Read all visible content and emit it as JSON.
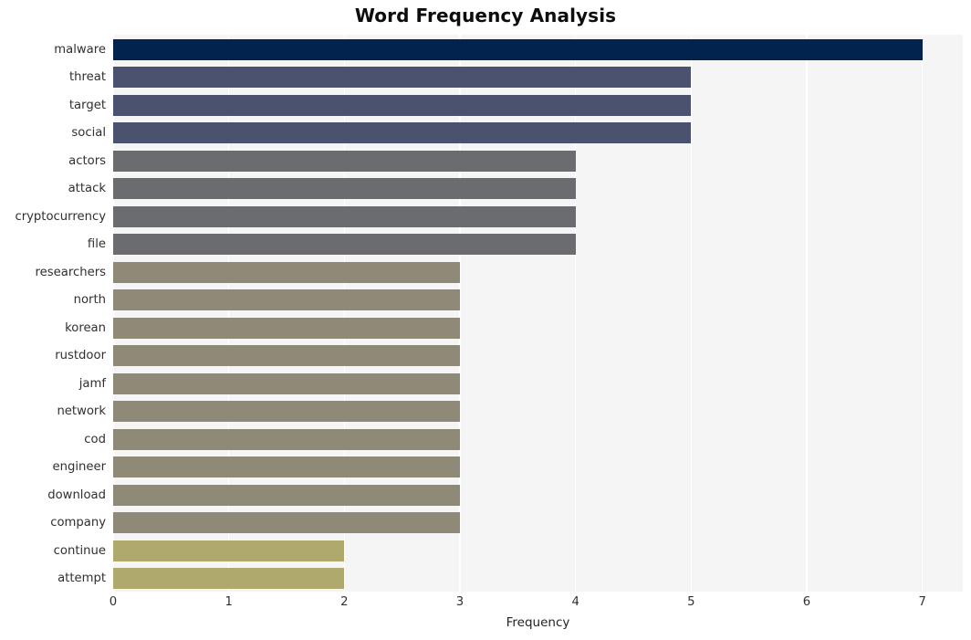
{
  "chart_data": {
    "type": "bar",
    "orientation": "horizontal",
    "title": "Word Frequency Analysis",
    "xlabel": "Frequency",
    "ylabel": "",
    "xlim": [
      0,
      7.35
    ],
    "xticks": [
      0,
      1,
      2,
      3,
      4,
      5,
      6,
      7
    ],
    "xtick_labels": [
      "0",
      "1",
      "2",
      "3",
      "4",
      "5",
      "6",
      "7"
    ],
    "grid": "vertical",
    "legend": "none",
    "categories": [
      "malware",
      "threat",
      "target",
      "social",
      "actors",
      "attack",
      "cryptocurrency",
      "file",
      "researchers",
      "north",
      "korean",
      "rustdoor",
      "jamf",
      "network",
      "cod",
      "engineer",
      "download",
      "company",
      "continue",
      "attempt"
    ],
    "values": [
      7,
      5,
      5,
      5,
      4,
      4,
      4,
      4,
      3,
      3,
      3,
      3,
      3,
      3,
      3,
      3,
      3,
      3,
      2,
      2
    ],
    "bar_colors": [
      "#03234f",
      "#4b5270",
      "#4b5270",
      "#4b5270",
      "#6b6c70",
      "#6b6c70",
      "#6b6c70",
      "#6b6c70",
      "#8e8a77",
      "#8e8a77",
      "#8e8a77",
      "#8e8a77",
      "#8e8a77",
      "#8e8a77",
      "#8e8a77",
      "#8e8a77",
      "#8e8a77",
      "#8e8a77",
      "#b0a96e",
      "#b0a96e"
    ]
  },
  "style": {
    "figure_background": "#ffffff",
    "panel_background": "#f5f5f6",
    "gridline_color": "#ffffff",
    "title_color": "#0d0d0d",
    "tick_label_color": "#303030"
  }
}
